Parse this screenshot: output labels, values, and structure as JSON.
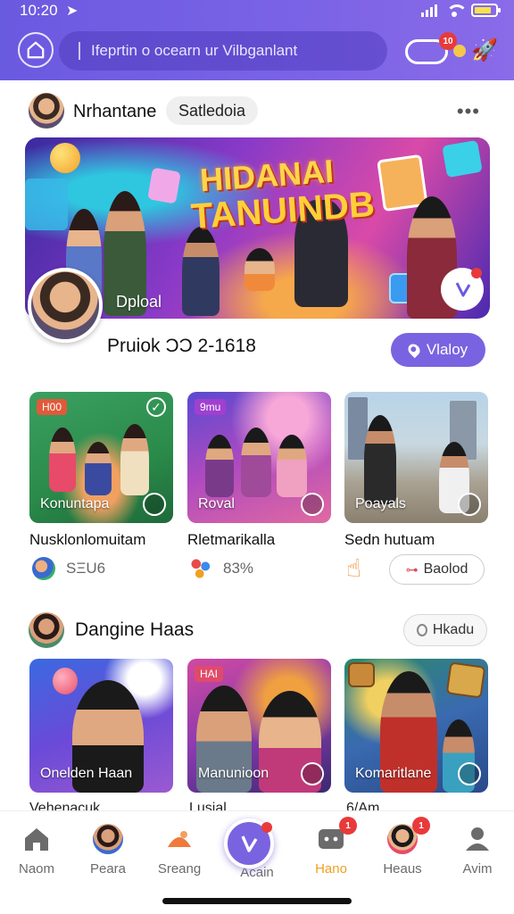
{
  "status": {
    "time": "10:20"
  },
  "search": {
    "text": "Ifeprtin o ocearn ur Vilbganlant"
  },
  "topbar": {
    "notif_badge": "10"
  },
  "post": {
    "author": "Nrhantane",
    "tag": "Satledoia",
    "hero_title_line1": "HIDANAI",
    "hero_title_line2": "TANUINDB",
    "hero_label": "Dploal",
    "count_text": "Pruiok ϽϽ 2-1618",
    "action_label": "Vlaloy"
  },
  "cards": [
    {
      "tag": "H00",
      "label": "Konuntapa",
      "title": "Nusklonlomuitam",
      "stat": "SΞU6",
      "tag_color": "#e05a3a"
    },
    {
      "tag": "9mu",
      "label": "Roval",
      "title": "Rletmarikalla",
      "stat": "83%",
      "tag_color": "#a040d0"
    },
    {
      "tag": "",
      "label": "Poayals",
      "title": "Sedn hutuam",
      "stat": "",
      "tag_color": ""
    }
  ],
  "cards_action": {
    "label": "Baolod"
  },
  "section2": {
    "title": "Dangine Haas",
    "action_label": "Hkadu",
    "cards": [
      {
        "tag": "",
        "label": "Onelden Haan"
      },
      {
        "tag": "HAI",
        "label": "Manunioon"
      },
      {
        "tag": "",
        "label": "Komaritlane"
      }
    ],
    "peek_left": "Vehenacuk",
    "peek_mid": "Lusial",
    "peek_right": "6/Am"
  },
  "nav": {
    "items": [
      {
        "label": "Naom",
        "icon": "home-icon"
      },
      {
        "label": "Peara",
        "icon": "profile-avatar-icon"
      },
      {
        "label": "Sreang",
        "icon": "hat-icon"
      },
      {
        "label": "Acain",
        "icon": "play-icon"
      },
      {
        "label": "Hano",
        "icon": "chat-icon",
        "badge": "1"
      },
      {
        "label": "Heaus",
        "icon": "friends-icon",
        "badge": "1"
      },
      {
        "label": "Avim",
        "icon": "person-icon"
      }
    ],
    "active_color": "#f0a020",
    "accent": "#7a63e0"
  }
}
